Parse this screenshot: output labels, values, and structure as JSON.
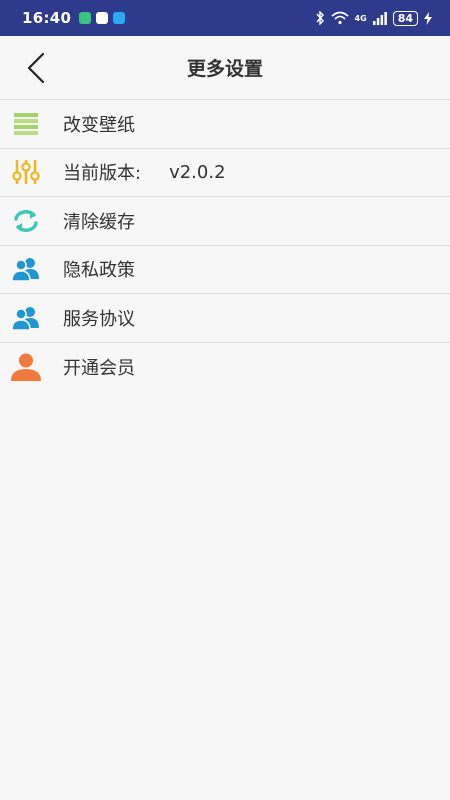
{
  "status_bar": {
    "time": "16:40",
    "network": "4G",
    "battery": "84"
  },
  "header": {
    "title": "更多设置"
  },
  "settings": [
    {
      "label": "改变壁纸",
      "icon": "wallpaper-icon",
      "color": "#a5d46a"
    },
    {
      "label": "当前版本:",
      "value": "v2.0.2",
      "icon": "equalizer-icon",
      "color": "#f2b51e"
    },
    {
      "label": "清除缓存",
      "icon": "refresh-icon",
      "color": "#3cc7b6"
    },
    {
      "label": "隐私政策",
      "icon": "users-icon",
      "color": "#2196d3"
    },
    {
      "label": "服务协议",
      "icon": "users-icon",
      "color": "#2196d3"
    },
    {
      "label": "开通会员",
      "icon": "user-icon",
      "color": "#f07a3b"
    }
  ]
}
